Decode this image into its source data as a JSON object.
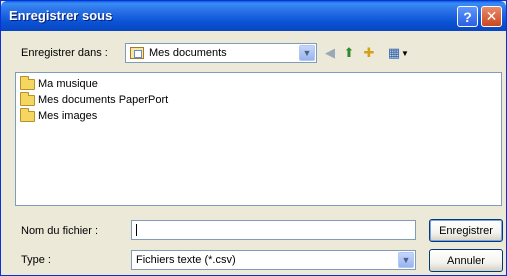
{
  "window": {
    "title": "Enregistrer sous",
    "help_glyph": "?",
    "close_glyph": "✕"
  },
  "save_in": {
    "label": "Enregistrer dans :",
    "value": "Mes documents"
  },
  "toolbar": {
    "icons": [
      "back-icon",
      "up-folder-icon",
      "new-folder-icon",
      "view-menu-icon"
    ]
  },
  "files": [
    {
      "name": "Ma musique"
    },
    {
      "name": "Mes documents PaperPort"
    },
    {
      "name": "Mes images"
    }
  ],
  "filename": {
    "label": "Nom du fichier :",
    "value": ""
  },
  "filetype": {
    "label": "Type :",
    "value": "Fichiers texte (*.csv)"
  },
  "buttons": {
    "save": "Enregistrer",
    "cancel": "Annuler"
  }
}
